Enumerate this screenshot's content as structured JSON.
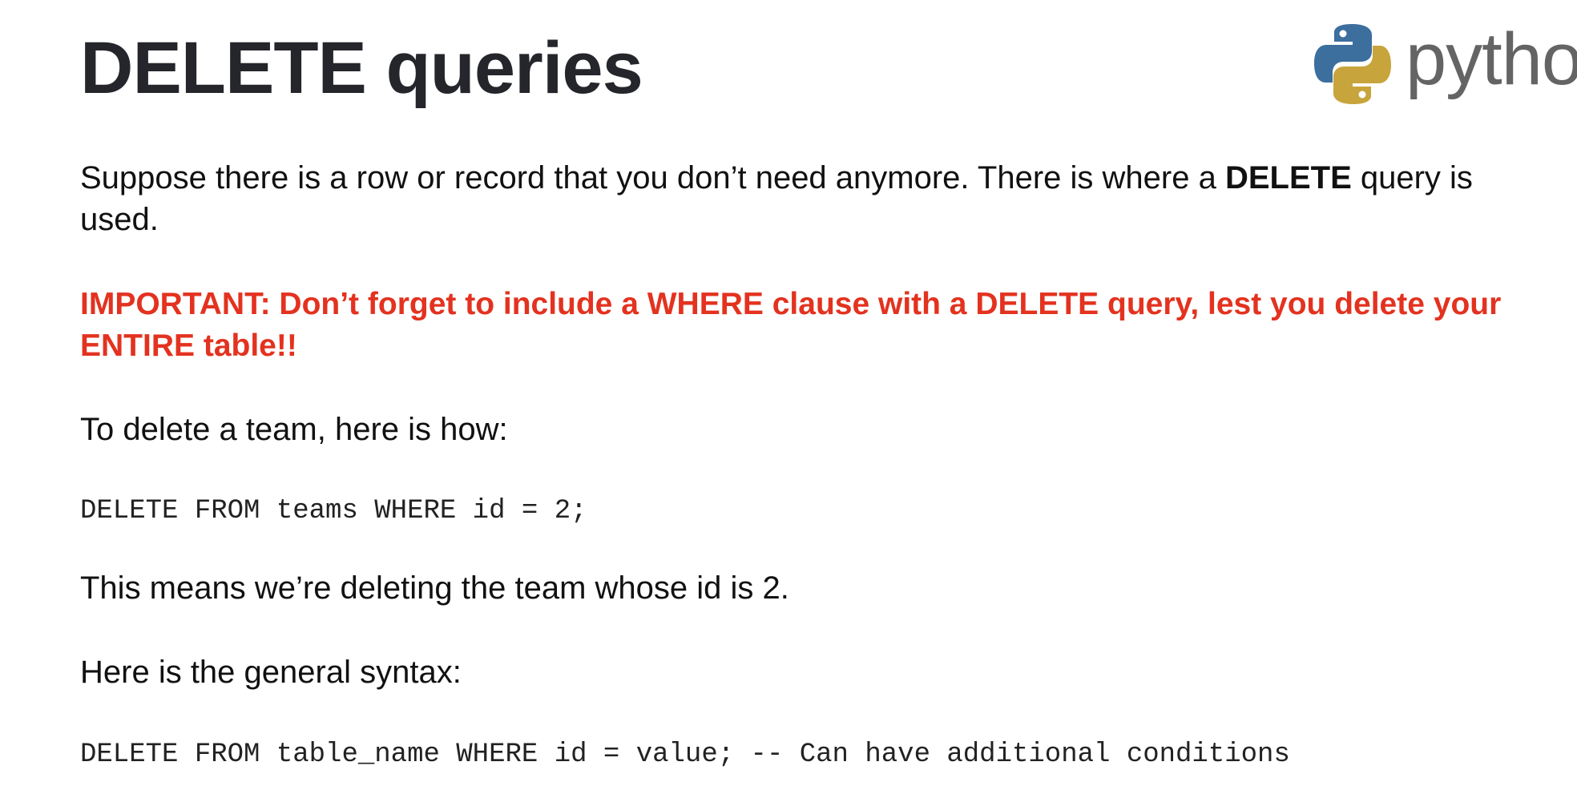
{
  "slide": {
    "title": "DELETE queries",
    "logo": {
      "icon": "python-logo-icon",
      "wordmark": "python",
      "colors": {
        "blue": "#3c6e9e",
        "yellow": "#c8a43c",
        "text": "#646464"
      }
    },
    "intro": {
      "text_before": "Suppose there is a row or record that you don’t need anymore.  There is where a ",
      "bold": "DELETE",
      "text_after": " query is used."
    },
    "warning": "IMPORTANT: Don’t forget to include a WHERE clause with a DELETE query, lest you delete your ENTIRE table!!",
    "howto": "To delete a team, here is how:",
    "example_code": "DELETE FROM teams WHERE id = 2;",
    "explanation": "This means we’re deleting the team whose id is 2.",
    "syntax_intro": "Here is the general syntax:",
    "general_code": "DELETE FROM table_name WHERE id = value; -- Can have additional conditions",
    "colors": {
      "title": "#25262b",
      "body": "#111111",
      "warning": "#e3321f"
    }
  }
}
